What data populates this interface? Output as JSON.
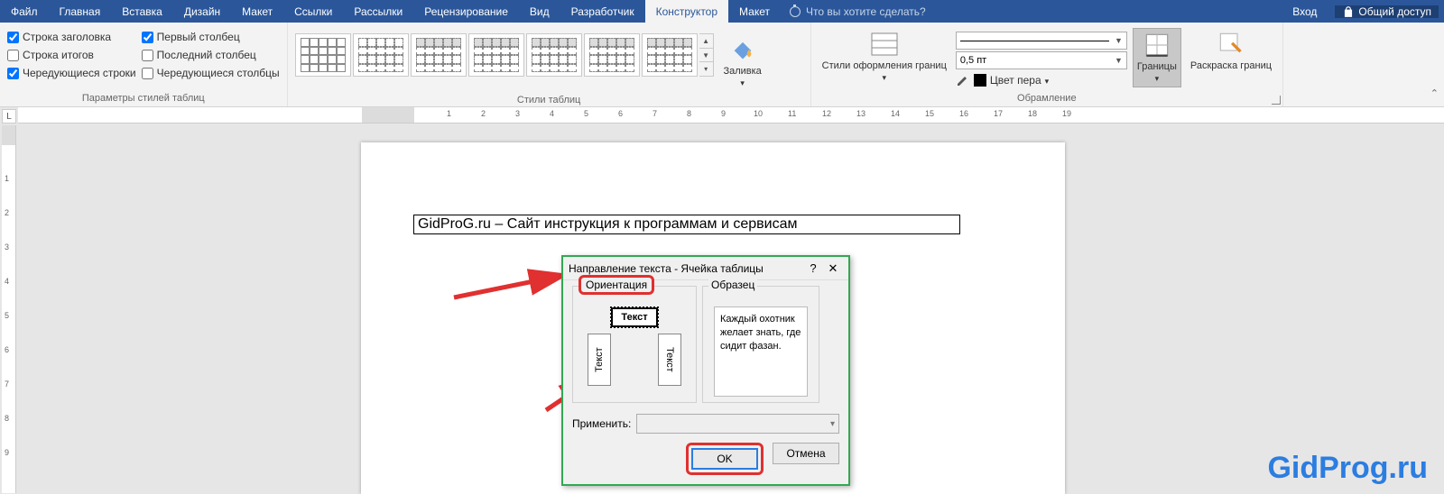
{
  "tabs": {
    "file": "Файл",
    "home": "Главная",
    "insert": "Вставка",
    "design": "Дизайн",
    "layout1": "Макет",
    "refs": "Ссылки",
    "mail": "Рассылки",
    "review": "Рецензирование",
    "view": "Вид",
    "dev": "Разработчик",
    "construct": "Конструктор",
    "layout2": "Макет"
  },
  "tell_placeholder": "Что вы хотите сделать?",
  "account": "Вход",
  "share": "Общий доступ",
  "options": {
    "header_row": "Строка заголовка",
    "total_row": "Строка итогов",
    "banded_rows": "Чередующиеся строки",
    "first_col": "Первый столбец",
    "last_col": "Последний столбец",
    "banded_cols": "Чередующиеся столбцы",
    "group": "Параметры стилей таблиц"
  },
  "styles_group": "Стили таблиц",
  "shading": "Заливка",
  "border_styles": "Стили оформления границ",
  "borders_group": "Обрамление",
  "line_weight": "0,5 пт",
  "pen_color": "Цвет пера",
  "borders": "Границы",
  "border_painter": "Раскраска границ",
  "ruler_corner": "L",
  "doc_text": "GidProG.ru – Сайт инструкция к программам и сервисам",
  "dialog": {
    "title": "Направление текста - Ячейка таблицы",
    "help": "?",
    "close": "✕",
    "orientation": "Ориентация",
    "sample": "Образец",
    "text": "Текст",
    "sample_text": "Каждый охотник желает знать, где сидит фазан.",
    "apply": "Применить:",
    "ok": "OK",
    "cancel": "Отмена"
  },
  "watermark": "GidProg.ru"
}
